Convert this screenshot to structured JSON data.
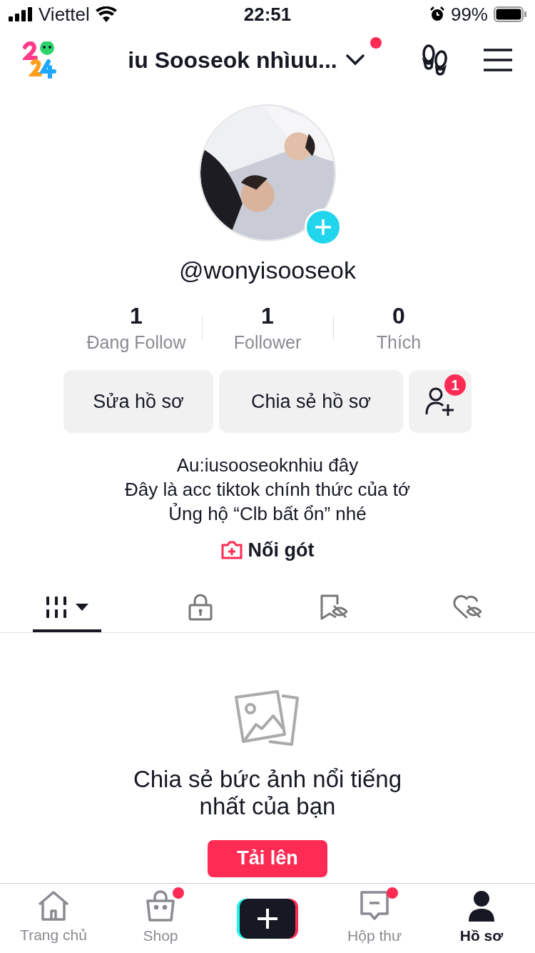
{
  "status_bar": {
    "carrier": "Viettel",
    "time": "22:51",
    "battery": "99%"
  },
  "header": {
    "title": "iu Sooseok nhìuu...",
    "has_dot": true
  },
  "profile": {
    "username": "@wonyisooseok",
    "stats": [
      {
        "value": "1",
        "label": "Đang Follow"
      },
      {
        "value": "1",
        "label": "Follower"
      },
      {
        "value": "0",
        "label": "Thích"
      }
    ],
    "edit_button": "Sửa hồ sơ",
    "share_button": "Chia sẻ hồ sơ",
    "friend_badge": "1",
    "bio": [
      "Au:iusooseoknhiu đây",
      "Đây là acc tiktok chính thức của tớ",
      "Ủng hộ “Clb bất ổn” nhé"
    ],
    "link": "Nối gót"
  },
  "tabs": [
    {
      "kind": "grid",
      "selected": true
    },
    {
      "kind": "private",
      "selected": false
    },
    {
      "kind": "saved",
      "selected": false
    },
    {
      "kind": "liked",
      "selected": false
    }
  ],
  "empty_state": {
    "title": "Chia sẻ bức ảnh nổi tiếng nhất của bạn",
    "button": "Tải lên"
  },
  "nav": [
    {
      "kind": "home",
      "label": "Trang chủ",
      "selected": false,
      "has_dot": false
    },
    {
      "kind": "shop",
      "label": "Shop",
      "selected": false,
      "has_dot": true
    },
    {
      "kind": "create"
    },
    {
      "kind": "inbox",
      "label": "Hộp thư",
      "selected": false,
      "has_dot": true
    },
    {
      "kind": "profile",
      "label": "Hồ sơ",
      "selected": true,
      "has_dot": false
    }
  ]
}
